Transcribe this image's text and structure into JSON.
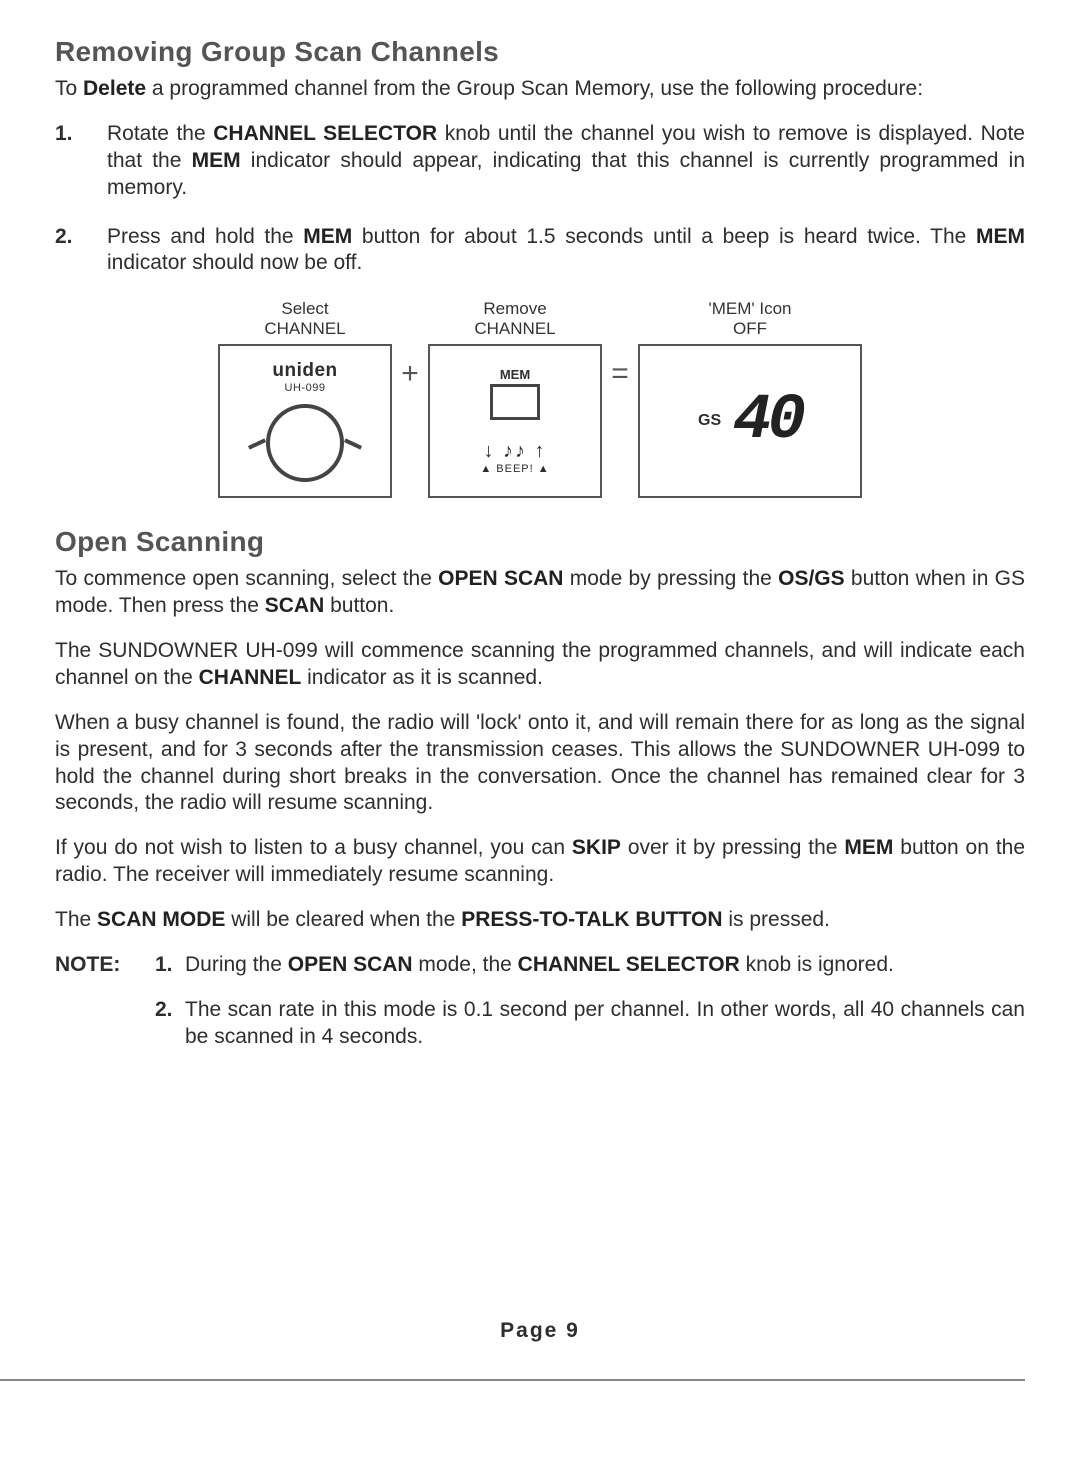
{
  "section1": {
    "title": "Removing Group Scan Channels",
    "intro": {
      "pre": "To ",
      "b1": "Delete",
      "post": " a programmed channel from the Group Scan Memory, use the following procedure:"
    },
    "steps": [
      {
        "n": "1.",
        "pre": "Rotate the ",
        "b1": "CHANNEL SELECTOR",
        "mid": " knob until the channel you wish to remove is displayed. Note that the ",
        "b2": "MEM",
        "post": " indicator should appear, indicating that this channel is currently programmed in memory."
      },
      {
        "n": "2.",
        "pre": "Press and hold the ",
        "b1": "MEM",
        "mid": " button for about 1.5 seconds until a beep is heard twice. The ",
        "b2": "MEM",
        "post": " indicator should now be off."
      }
    ]
  },
  "diagram": {
    "col1": {
      "cap1": "Select",
      "cap2": "CHANNEL",
      "brand": "uniden",
      "model": "UH-099"
    },
    "op1": "+",
    "col2": {
      "cap1": "Remove",
      "cap2": "CHANNEL",
      "mem": "MEM",
      "beep_notes": "♪♪",
      "beep": "BEEP!"
    },
    "op2": "=",
    "col3": {
      "cap1": "'MEM' Icon",
      "cap2": "OFF",
      "gs": "GS",
      "val": "40"
    }
  },
  "section2": {
    "title": "Open Scanning",
    "p1": {
      "pre": "To commence open scanning, select the ",
      "b1": "OPEN SCAN",
      "mid": " mode by pressing the ",
      "b2": "OS/GS",
      "mid2": " button when in GS mode. Then press the ",
      "b3": "SCAN",
      "post": " button."
    },
    "p2": {
      "pre": "The SUNDOWNER UH-099 will commence scanning the programmed channels, and will indicate each channel on the ",
      "b1": "CHANNEL",
      "post": " indicator as it is scanned."
    },
    "p3": "When a busy channel is found, the radio will 'lock' onto it, and will remain there for as long as the signal is present, and for 3 seconds after the transmission ceases. This allows the SUNDOWNER UH-099 to hold the channel during short breaks in the conversation. Once the channel has remained clear for 3 seconds, the radio will resume scanning.",
    "p4": {
      "pre": "If you do not wish to listen to a busy channel, you can ",
      "b1": "SKIP",
      "mid": " over it by pressing the ",
      "b2": "MEM",
      "post": " button on the radio. The receiver will immediately resume scanning."
    },
    "p5": {
      "pre": "The ",
      "b1": "SCAN MODE",
      "mid": " will be cleared when the ",
      "b2": "PRESS-TO-TALK BUTTON",
      "post": " is pressed."
    },
    "note_label": "NOTE:",
    "notes": [
      {
        "n": "1.",
        "pre": "During the ",
        "b1": "OPEN SCAN",
        "mid": " mode, the ",
        "b2": "CHANNEL SELECTOR",
        "post": " knob is ignored."
      },
      {
        "n": "2.",
        "txt": "The scan rate in this mode is 0.1 second per channel. In other words, all 40 channels can be scanned in 4 seconds."
      }
    ]
  },
  "page_number": "Page  9"
}
